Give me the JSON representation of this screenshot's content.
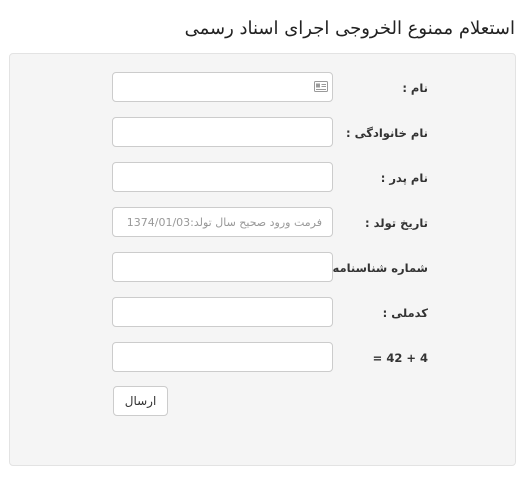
{
  "page": {
    "title": "استعلام ممنوع الخروجی اجرای اسناد رسمی"
  },
  "form": {
    "fields": [
      {
        "label": "نام :",
        "value": "",
        "placeholder": "",
        "icon": "id-card-icon"
      },
      {
        "label": "نام خانوادگی :",
        "value": "",
        "placeholder": ""
      },
      {
        "label": "نام پدر :",
        "value": "",
        "placeholder": ""
      },
      {
        "label": "تاریخ تولد :",
        "value": "",
        "placeholder": "فرمت ورود صحیح سال تولد:1374/01/03"
      },
      {
        "label": "شماره شناسنامه",
        "value": "",
        "placeholder": ""
      },
      {
        "label": "کدملی :",
        "value": "",
        "placeholder": ""
      },
      {
        "label": "4 + 42 =",
        "value": "",
        "placeholder": ""
      }
    ],
    "submit_label": "ارسال"
  }
}
